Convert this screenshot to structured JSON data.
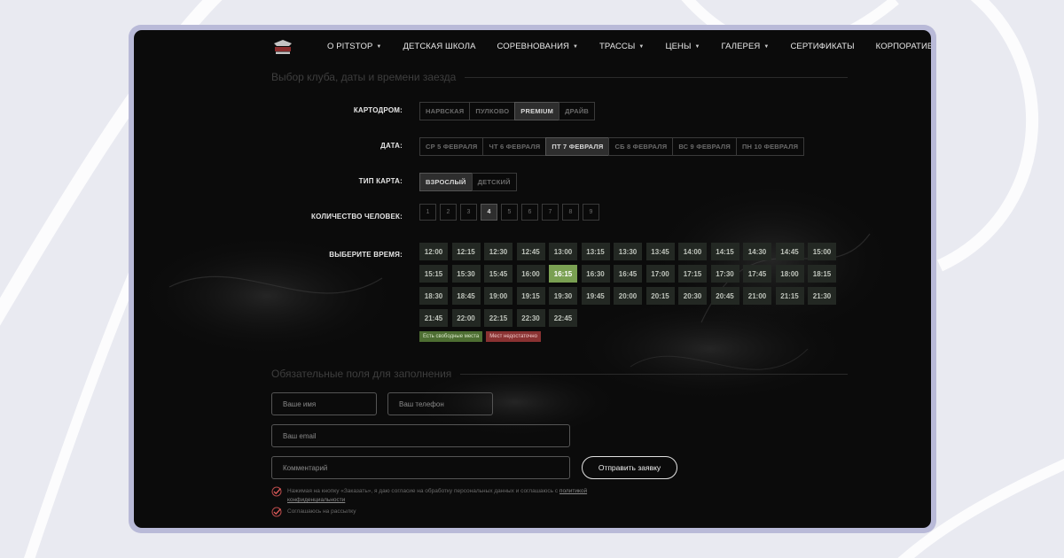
{
  "nav": {
    "items": [
      {
        "label": "О PITSTOP",
        "dropdown": true
      },
      {
        "label": "ДЕТСКАЯ ШКОЛА",
        "dropdown": false
      },
      {
        "label": "СОРЕВНОВАНИЯ",
        "dropdown": true
      },
      {
        "label": "ТРАССЫ",
        "dropdown": true
      },
      {
        "label": "ЦЕНЫ",
        "dropdown": true
      },
      {
        "label": "ГАЛЕРЕЯ",
        "dropdown": true
      },
      {
        "label": "СЕРТИФИКАТЫ",
        "dropdown": false
      },
      {
        "label": "КОРПОРАТИВЫ",
        "dropdown": false
      }
    ]
  },
  "booking": {
    "section_title": "Выбор клуба, даты и времени заезда",
    "kartodrom": {
      "label": "КАРТОДРОМ:",
      "options": [
        "НАРВСКАЯ",
        "ПУЛКОВО",
        "PREMIUM",
        "ДРАЙВ"
      ],
      "selected": "PREMIUM"
    },
    "date": {
      "label": "ДАТА:",
      "options": [
        "СР 5 ФЕВРАЛЯ",
        "ЧТ 6 ФЕВРАЛЯ",
        "ПТ 7 ФЕВРАЛЯ",
        "СБ 8 ФЕВРАЛЯ",
        "ВС 9 ФЕВРАЛЯ",
        "ПН 10 ФЕВРАЛЯ"
      ],
      "selected": "ПТ 7 ФЕВРАЛЯ"
    },
    "kart_type": {
      "label": "ТИП КАРТА:",
      "options": [
        "ВЗРОСЛЫЙ",
        "ДЕТСКИЙ"
      ],
      "selected": "ВЗРОСЛЫЙ"
    },
    "people": {
      "label": "КОЛИЧЕСТВО ЧЕЛОВЕК:",
      "options": [
        "1",
        "2",
        "3",
        "4",
        "5",
        "6",
        "7",
        "8",
        "9"
      ],
      "selected": "4"
    },
    "time": {
      "label": "ВЫБЕРИТЕ ВРЕМЯ:",
      "slots": [
        "12:00",
        "12:15",
        "12:30",
        "12:45",
        "13:00",
        "13:15",
        "13:30",
        "13:45",
        "14:00",
        "14:15",
        "14:30",
        "14:45",
        "15:00",
        "15:15",
        "15:30",
        "15:45",
        "16:00",
        "16:15",
        "16:30",
        "16:45",
        "17:00",
        "17:15",
        "17:30",
        "17:45",
        "18:00",
        "18:15",
        "18:30",
        "18:45",
        "19:00",
        "19:15",
        "19:30",
        "19:45",
        "20:00",
        "20:15",
        "20:30",
        "20:45",
        "21:00",
        "21:15",
        "21:30",
        "21:45",
        "22:00",
        "22:15",
        "22:30",
        "22:45"
      ],
      "selected": "16:15"
    },
    "legend": {
      "available": "Есть свободные места",
      "unavailable": "Мест недостаточно"
    }
  },
  "form": {
    "section_title": "Обязательные поля для заполнения",
    "name_placeholder": "Ваше имя",
    "phone_placeholder": "Ваш телефон",
    "email_placeholder": "Ваш email",
    "comment_placeholder": "Комментарий",
    "submit_label": "Отправить заявку",
    "consent_text": "Нажимая на кнопку «Заказать», я даю согласие на обработку персональных данных и соглашаюсь с",
    "consent_link": "политикой конфиденциальности",
    "newsletter_text": "Соглашаюсь на рассылку"
  },
  "colors": {
    "available": "#4d6e32",
    "unavailable": "#8a3232",
    "selected_slot": "#7aa052",
    "frame": "#b9bad8"
  }
}
